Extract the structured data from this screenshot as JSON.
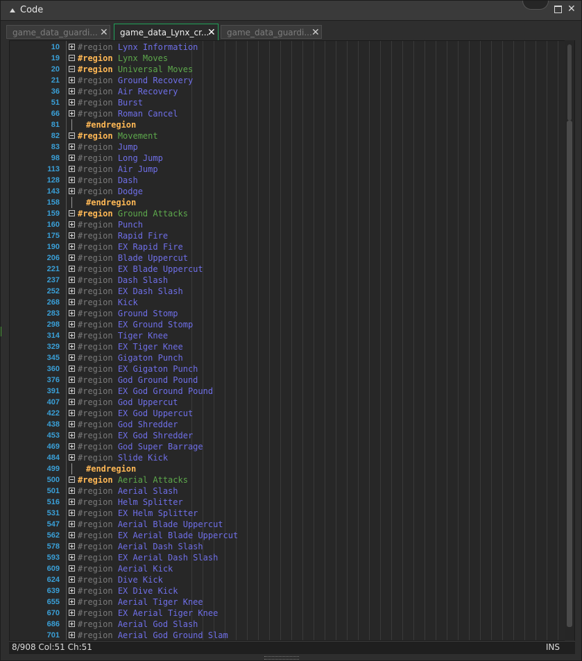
{
  "panel": {
    "title": "Code"
  },
  "tabs": [
    {
      "label": "game_data_guardi...",
      "active": false
    },
    {
      "label": "game_data_Lynx_cr...",
      "active": true
    },
    {
      "label": "game_data_guardi...",
      "active": false
    }
  ],
  "tab_close_glyph": "✕",
  "lines": [
    {
      "num": "10",
      "fold": "plus",
      "kw": "#region",
      "kwstyle": "gray",
      "name": "Lynx Information",
      "namestyle": "blue"
    },
    {
      "num": "19",
      "fold": "minus",
      "kw": "#region",
      "kwstyle": "orange",
      "name": "Lynx Moves",
      "namestyle": "green"
    },
    {
      "num": "20",
      "fold": "minus",
      "kw": "#region",
      "kwstyle": "orange",
      "name": "Universal Moves",
      "namestyle": "green"
    },
    {
      "num": "21",
      "fold": "plus",
      "kw": "#region",
      "kwstyle": "gray",
      "name": "Ground Recovery",
      "namestyle": "blue"
    },
    {
      "num": "36",
      "fold": "plus",
      "kw": "#region",
      "kwstyle": "gray",
      "name": "Air Recovery",
      "namestyle": "blue"
    },
    {
      "num": "51",
      "fold": "plus",
      "kw": "#region",
      "kwstyle": "gray",
      "name": "Burst",
      "namestyle": "blue"
    },
    {
      "num": "66",
      "fold": "plus",
      "kw": "#region",
      "kwstyle": "gray",
      "name": "Roman Cancel",
      "namestyle": "blue"
    },
    {
      "num": "81",
      "fold": "line",
      "kw": "#endregion",
      "kwstyle": "orange",
      "name": "",
      "namestyle": "blue"
    },
    {
      "num": "82",
      "fold": "minus",
      "kw": "#region",
      "kwstyle": "orange",
      "name": "Movement",
      "namestyle": "green"
    },
    {
      "num": "83",
      "fold": "plus",
      "kw": "#region",
      "kwstyle": "gray",
      "name": "Jump",
      "namestyle": "blue"
    },
    {
      "num": "98",
      "fold": "plus",
      "kw": "#region",
      "kwstyle": "gray",
      "name": "Long Jump",
      "namestyle": "blue"
    },
    {
      "num": "113",
      "fold": "plus",
      "kw": "#region",
      "kwstyle": "gray",
      "name": "Air Jump",
      "namestyle": "blue"
    },
    {
      "num": "128",
      "fold": "plus",
      "kw": "#region",
      "kwstyle": "gray",
      "name": "Dash",
      "namestyle": "blue"
    },
    {
      "num": "143",
      "fold": "plus",
      "kw": "#region",
      "kwstyle": "gray",
      "name": "Dodge",
      "namestyle": "blue"
    },
    {
      "num": "158",
      "fold": "line",
      "kw": "#endregion",
      "kwstyle": "orange",
      "name": "",
      "namestyle": "blue"
    },
    {
      "num": "159",
      "fold": "minus",
      "kw": "#region",
      "kwstyle": "orange",
      "name": "Ground Attacks",
      "namestyle": "green"
    },
    {
      "num": "160",
      "fold": "plus",
      "kw": "#region",
      "kwstyle": "gray",
      "name": "Punch",
      "namestyle": "blue"
    },
    {
      "num": "175",
      "fold": "plus",
      "kw": "#region",
      "kwstyle": "gray",
      "name": "Rapid Fire",
      "namestyle": "blue"
    },
    {
      "num": "190",
      "fold": "plus",
      "kw": "#region",
      "kwstyle": "gray",
      "name": "EX Rapid Fire",
      "namestyle": "blue"
    },
    {
      "num": "206",
      "fold": "plus",
      "kw": "#region",
      "kwstyle": "gray",
      "name": "Blade Uppercut",
      "namestyle": "blue"
    },
    {
      "num": "221",
      "fold": "plus",
      "kw": "#region",
      "kwstyle": "gray",
      "name": "EX Blade Uppercut",
      "namestyle": "blue"
    },
    {
      "num": "237",
      "fold": "plus",
      "kw": "#region",
      "kwstyle": "gray",
      "name": "Dash Slash",
      "namestyle": "blue"
    },
    {
      "num": "252",
      "fold": "plus",
      "kw": "#region",
      "kwstyle": "gray",
      "name": "EX Dash Slash",
      "namestyle": "blue"
    },
    {
      "num": "268",
      "fold": "plus",
      "kw": "#region",
      "kwstyle": "gray",
      "name": "Kick",
      "namestyle": "blue"
    },
    {
      "num": "283",
      "fold": "plus",
      "kw": "#region",
      "kwstyle": "gray",
      "name": "Ground Stomp",
      "namestyle": "blue"
    },
    {
      "num": "298",
      "fold": "plus",
      "kw": "#region",
      "kwstyle": "gray",
      "name": "EX Ground Stomp",
      "namestyle": "blue"
    },
    {
      "num": "314",
      "fold": "plus",
      "kw": "#region",
      "kwstyle": "gray",
      "name": "Tiger Knee",
      "namestyle": "blue"
    },
    {
      "num": "329",
      "fold": "plus",
      "kw": "#region",
      "kwstyle": "gray",
      "name": "EX Tiger Knee",
      "namestyle": "blue"
    },
    {
      "num": "345",
      "fold": "plus",
      "kw": "#region",
      "kwstyle": "gray",
      "name": "Gigaton Punch",
      "namestyle": "blue"
    },
    {
      "num": "360",
      "fold": "plus",
      "kw": "#region",
      "kwstyle": "gray",
      "name": "EX Gigaton Punch",
      "namestyle": "blue"
    },
    {
      "num": "376",
      "fold": "plus",
      "kw": "#region",
      "kwstyle": "gray",
      "name": "God Ground Pound",
      "namestyle": "blue"
    },
    {
      "num": "391",
      "fold": "plus",
      "kw": "#region",
      "kwstyle": "gray",
      "name": "EX God Ground Pound",
      "namestyle": "blue"
    },
    {
      "num": "407",
      "fold": "plus",
      "kw": "#region",
      "kwstyle": "gray",
      "name": "God Uppercut",
      "namestyle": "blue"
    },
    {
      "num": "422",
      "fold": "plus",
      "kw": "#region",
      "kwstyle": "gray",
      "name": "EX God Uppercut",
      "namestyle": "blue"
    },
    {
      "num": "438",
      "fold": "plus",
      "kw": "#region",
      "kwstyle": "gray",
      "name": "God Shredder",
      "namestyle": "blue"
    },
    {
      "num": "453",
      "fold": "plus",
      "kw": "#region",
      "kwstyle": "gray",
      "name": "EX God Shredder",
      "namestyle": "blue"
    },
    {
      "num": "469",
      "fold": "plus",
      "kw": "#region",
      "kwstyle": "gray",
      "name": "God Super Barrage",
      "namestyle": "blue"
    },
    {
      "num": "484",
      "fold": "plus",
      "kw": "#region",
      "kwstyle": "gray",
      "name": "Slide Kick",
      "namestyle": "blue"
    },
    {
      "num": "499",
      "fold": "line",
      "kw": "#endregion",
      "kwstyle": "orange",
      "name": "",
      "namestyle": "blue"
    },
    {
      "num": "500",
      "fold": "minus",
      "kw": "#region",
      "kwstyle": "orange",
      "name": "Aerial Attacks",
      "namestyle": "green"
    },
    {
      "num": "501",
      "fold": "plus",
      "kw": "#region",
      "kwstyle": "gray",
      "name": "Aerial Slash",
      "namestyle": "blue"
    },
    {
      "num": "516",
      "fold": "plus",
      "kw": "#region",
      "kwstyle": "gray",
      "name": "Helm Splitter",
      "namestyle": "blue"
    },
    {
      "num": "531",
      "fold": "plus",
      "kw": "#region",
      "kwstyle": "gray",
      "name": "EX Helm Splitter",
      "namestyle": "blue"
    },
    {
      "num": "547",
      "fold": "plus",
      "kw": "#region",
      "kwstyle": "gray",
      "name": "Aerial Blade Uppercut",
      "namestyle": "blue"
    },
    {
      "num": "562",
      "fold": "plus",
      "kw": "#region",
      "kwstyle": "gray",
      "name": "EX Aerial Blade Uppercut",
      "namestyle": "blue"
    },
    {
      "num": "578",
      "fold": "plus",
      "kw": "#region",
      "kwstyle": "gray",
      "name": "Aerial Dash Slash",
      "namestyle": "blue"
    },
    {
      "num": "593",
      "fold": "plus",
      "kw": "#region",
      "kwstyle": "gray",
      "name": "EX Aerial Dash Slash",
      "namestyle": "blue"
    },
    {
      "num": "609",
      "fold": "plus",
      "kw": "#region",
      "kwstyle": "gray",
      "name": "Aerial Kick",
      "namestyle": "blue"
    },
    {
      "num": "624",
      "fold": "plus",
      "kw": "#region",
      "kwstyle": "gray",
      "name": "Dive Kick",
      "namestyle": "blue"
    },
    {
      "num": "639",
      "fold": "plus",
      "kw": "#region",
      "kwstyle": "gray",
      "name": "EX Dive Kick",
      "namestyle": "blue"
    },
    {
      "num": "655",
      "fold": "plus",
      "kw": "#region",
      "kwstyle": "gray",
      "name": "Aerial Tiger Knee",
      "namestyle": "blue"
    },
    {
      "num": "670",
      "fold": "plus",
      "kw": "#region",
      "kwstyle": "gray",
      "name": "EX Aerial Tiger Knee",
      "namestyle": "blue"
    },
    {
      "num": "686",
      "fold": "plus",
      "kw": "#region",
      "kwstyle": "gray",
      "name": "Aerial God Slash",
      "namestyle": "blue"
    },
    {
      "num": "701",
      "fold": "plus",
      "kw": "#region",
      "kwstyle": "gray",
      "name": "Aerial God Ground Slam",
      "namestyle": "blue"
    }
  ],
  "status": {
    "position": "8/908 Col:51 Ch:51",
    "mode": "INS"
  },
  "colors": {
    "accent_tab": "#20a35a",
    "line_number": "#3aa0d8",
    "region_keyword": "#7b7b7b",
    "region_open": "#ffb855",
    "region_name": "#6f6fe8",
    "group_name": "#5da84c"
  }
}
